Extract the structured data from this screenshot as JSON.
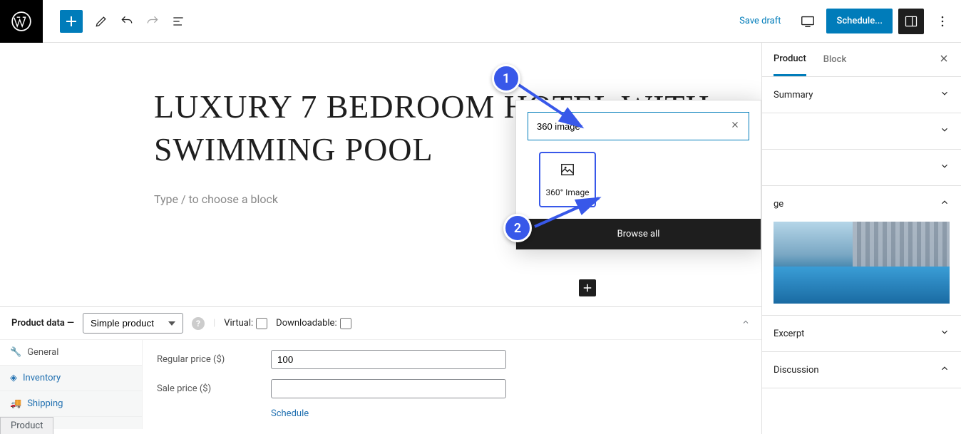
{
  "topbar": {
    "save_draft": "Save draft",
    "schedule": "Schedule..."
  },
  "editor": {
    "title": "LUXURY 7 BEDROOM HOTEL WITH SWIMMING POOL",
    "placeholder": "Type / to choose a block"
  },
  "inserter": {
    "search_value": "360 image",
    "block_result_label": "360° Image",
    "browse_all": "Browse all"
  },
  "callouts": {
    "one": "1",
    "two": "2"
  },
  "product_data": {
    "label": "Product data —",
    "select_value": "Simple product",
    "virtual_label": "Virtual:",
    "downloadable_label": "Downloadable:",
    "tabs": {
      "general": "General",
      "inventory": "Inventory",
      "shipping": "Shipping"
    },
    "regular_price_label": "Regular price ($)",
    "regular_price_value": "100",
    "sale_price_label": "Sale price ($)",
    "sale_price_value": "",
    "schedule_link": "Schedule"
  },
  "sidebar": {
    "tabs": {
      "product": "Product",
      "block": "Block"
    },
    "panels": {
      "summary": "Summary",
      "image_truncated": "ge",
      "excerpt": "Excerpt",
      "discussion": "Discussion"
    }
  },
  "bottom_tab": "Product"
}
